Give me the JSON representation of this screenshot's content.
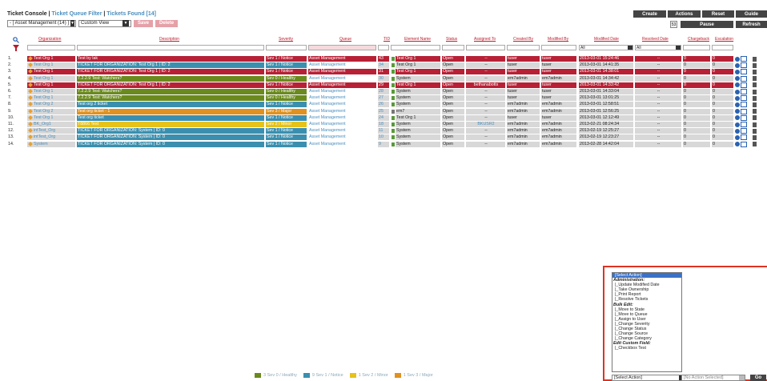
{
  "header": {
    "title": "Ticket Console",
    "sep1": " | ",
    "filter_link": "Ticket Queue Filter",
    "sep2": " | ",
    "found": "Tickets Found [14]",
    "queue_select": "- [ Asset Management (14) ]",
    "view_select": "Custom View",
    "save_label": "Save",
    "delete_label": "Delete",
    "create_label": "Create",
    "actions_label": "Actions",
    "reset_label": "Reset",
    "guide_label": "Guide",
    "pause_label": "Pause",
    "refresh_label": "Refresh",
    "counter": "53"
  },
  "columns": {
    "organization": "Organization",
    "description": "Description",
    "severity": "Severity",
    "queue": "Queue",
    "tid": "TID",
    "element": "Element Name",
    "status": "Status",
    "assigned": "Assigned To",
    "created": "Created By",
    "modified_by": "Modified By",
    "modified_date": "Modified Date",
    "resolved_date": "Resolved Date",
    "chargeback": "Chargeback",
    "escalation": "Escalation"
  },
  "filters": {
    "modified_all": "All",
    "resolved_all": "All"
  },
  "colors": {
    "red": "#b82035",
    "gray": "#9a9a9a",
    "green": "#6a8a1e",
    "orange": "#e0911f",
    "teal": "#3b8fae",
    "yellow": "#e6c21a"
  },
  "rows": [
    {
      "num": "1.",
      "org": "Test Org 1",
      "desc": "Test by lak",
      "sev": "Sev 1 / Notice",
      "queue": "Asset Management",
      "tid": "43",
      "el": "Test Org 1",
      "status": "Open",
      "assigned": "--",
      "created": "tuser",
      "modby": "tuser",
      "moddate": "2013-03-01 15:24:46",
      "resolved": "--",
      "charge": "0",
      "esc": "0",
      "color": "red"
    },
    {
      "num": "2.",
      "org": "Test Org 1",
      "desc": "TICKET FOR ORGANIZATION: Test Org 1 | ID: 2",
      "sev": "Sev 1 / Notice",
      "queue": "Asset Management",
      "tid": "34",
      "el": "Test Org 1",
      "status": "Open",
      "assigned": "--",
      "created": "tuser",
      "modby": "tuser",
      "moddate": "2013-03-01 14:41:35",
      "resolved": "--",
      "charge": "0",
      "esc": "0",
      "color": "gray"
    },
    {
      "num": "3.",
      "org": "Test Org 1",
      "desc": "TICKET FOR ORGANIZATION: Test Org 1 | ID: 2",
      "sev": "Sev 1 / Notice",
      "queue": "Asset Management",
      "tid": "31",
      "el": "Test Org 1",
      "status": "Open",
      "assigned": "--",
      "created": "tuser",
      "modby": "tuser",
      "moddate": "2013-03-01 14:38:01",
      "resolved": "--",
      "charge": "0",
      "esc": "0",
      "color": "red"
    },
    {
      "num": "4.",
      "org": "Test Org 1",
      "desc": "7.2.2.9 Test: Watchers?",
      "sev": "Sev 0 / Healthy",
      "queue": "Asset Management",
      "tid": "30",
      "el": "System",
      "status": "Open",
      "assigned": "--",
      "created": "em7admin",
      "modby": "em7admin",
      "moddate": "2013-03-01 14:34:42",
      "resolved": "--",
      "charge": "0",
      "esc": "0",
      "color": "gray"
    },
    {
      "num": "5.",
      "org": "Test Org 1",
      "desc": "TICKET FOR ORGANIZATION: Test Org 1 | ID: 2",
      "sev": "Sev 1 / Notice",
      "queue": "Asset Management",
      "tid": "29",
      "el": "Test Org 1",
      "status": "Open",
      "assigned": "bethanabotts",
      "created": "tuser",
      "modby": "tuser",
      "moddate": "2013-03-01 14:33:42",
      "resolved": "--",
      "charge": "0",
      "esc": "0",
      "color": "red"
    },
    {
      "num": "6.",
      "org": "Test Org 1",
      "desc": "7.2.2.9 Test: Watchers?",
      "sev": "Sev 0 / Healthy",
      "queue": "Asset Management",
      "tid": "28",
      "el": "System",
      "status": "Open",
      "assigned": "--",
      "created": "tuser",
      "modby": "tuser",
      "moddate": "2013-03-01 14:33:04",
      "resolved": "--",
      "charge": "0",
      "esc": "0",
      "color": "gray"
    },
    {
      "num": "7.",
      "org": "Test Org 1",
      "desc": "7.2.2.9 Test: Watchers?",
      "sev": "Sev 0 / Healthy",
      "queue": "Asset Management",
      "tid": "27",
      "el": "System",
      "status": "Open",
      "assigned": "--",
      "created": "tuser",
      "modby": "tuser",
      "moddate": "2013-03-01 13:01:25",
      "resolved": "--",
      "charge": "0",
      "esc": "0",
      "color": "gray"
    },
    {
      "num": "8.",
      "org": "Test Org 2",
      "desc": "Test org 2 ticket",
      "sev": "Sev 1 / Notice",
      "queue": "Asset Management",
      "tid": "26",
      "el": "System",
      "status": "Open",
      "assigned": "--",
      "created": "em7admin",
      "modby": "em7admin",
      "moddate": "2013-03-01 12:58:51",
      "resolved": "--",
      "charge": "0",
      "esc": "0",
      "color": "gray"
    },
    {
      "num": "9.",
      "org": "Test Org 2",
      "desc": "Test org ticket - 1",
      "sev": "Sev 3 / Major",
      "queue": "Asset Management",
      "tid": "25",
      "el": "em7",
      "status": "Open",
      "assigned": "--",
      "created": "em7admin",
      "modby": "em7admin",
      "moddate": "2013-03-01 12:56:25",
      "resolved": "--",
      "charge": "0",
      "esc": "0",
      "color": "gray"
    },
    {
      "num": "10.",
      "org": "Test Org 1",
      "desc": "Test org ticket",
      "sev": "Sev 1 / Notice",
      "queue": "Asset Management",
      "tid": "24",
      "el": "Test Org 1",
      "status": "Open",
      "assigned": "--",
      "created": "tuser",
      "modby": "tuser",
      "moddate": "2013-03-01 12:12:49",
      "resolved": "--",
      "charge": "0",
      "esc": "0",
      "color": "gray"
    },
    {
      "num": "11.",
      "org": "BK_Org1",
      "desc": "T8866 Test",
      "sev": "Sev 2 / Minor",
      "queue": "Asset Management",
      "tid": "18",
      "el": "System",
      "status": "Open",
      "assigned": "BKUSR2",
      "created": "em7admin",
      "modby": "em7admin",
      "moddate": "2013-02-21 08:24:34",
      "resolved": "--",
      "charge": "0",
      "esc": "0",
      "color": "gray"
    },
    {
      "num": "12.",
      "org": "intTest_Org",
      "desc": "TICKET FOR ORGANIZATION: System | ID: 0",
      "sev": "Sev 1 / Notice",
      "queue": "Asset Management",
      "tid": "11",
      "el": "System",
      "status": "Open",
      "assigned": "--",
      "created": "em7admin",
      "modby": "em7admin",
      "moddate": "2013-02-19 12:25:27",
      "resolved": "--",
      "charge": "0",
      "esc": "0",
      "color": "gray"
    },
    {
      "num": "13.",
      "org": "intTest_Org",
      "desc": "TICKET FOR ORGANIZATION: System | ID: 0",
      "sev": "Sev 1 / Notice",
      "queue": "Asset Management",
      "tid": "10",
      "el": "System",
      "status": "Open",
      "assigned": "--",
      "created": "em7admin",
      "modby": "em7admin",
      "moddate": "2013-02-19 12:23:27",
      "resolved": "--",
      "charge": "0",
      "esc": "0",
      "color": "gray"
    },
    {
      "num": "14.",
      "org": "System",
      "desc": "TICKET FOR ORGANIZATION: System | ID: 0",
      "sev": "Sev 1 / Notice",
      "queue": "Asset Management",
      "tid": "9",
      "el": "System",
      "status": "Open",
      "assigned": "--",
      "created": "em7admin",
      "modby": "em7admin",
      "moddate": "2013-02-28 14:42:04",
      "resolved": "--",
      "charge": "0",
      "esc": "0",
      "color": "gray"
    }
  ],
  "action_menu": [
    {
      "label": "[Select Action]",
      "type": "selected"
    },
    {
      "label": "Administration:",
      "type": "group"
    },
    {
      "label": "|_Update Modified Date",
      "type": "item"
    },
    {
      "label": "|_Take Ownership",
      "type": "item"
    },
    {
      "label": "|_Print Report",
      "type": "item"
    },
    {
      "label": "|_Resolve Tickets",
      "type": "item"
    },
    {
      "label": "Bulk Edit:",
      "type": "group"
    },
    {
      "label": "|_Move to State",
      "type": "item"
    },
    {
      "label": "|_Move to Queue",
      "type": "item"
    },
    {
      "label": "|_Assign to User",
      "type": "item"
    },
    {
      "label": "|_Change Severity",
      "type": "item"
    },
    {
      "label": "|_Change Status",
      "type": "item"
    },
    {
      "label": "|_Change Source",
      "type": "item"
    },
    {
      "label": "|_Change Category",
      "type": "item"
    },
    {
      "label": "Edit Custom Field:",
      "type": "group"
    },
    {
      "label": "|_Checkbox Test",
      "type": "item"
    }
  ],
  "bottom": {
    "select_action": "[Select Action]",
    "no_action": "[No Action Selected]",
    "go_label": "Go"
  },
  "legend": [
    {
      "label": "3 Sev 0 / Healthy",
      "color": "#6a8a1e"
    },
    {
      "label": "9 Sev 1 / Notice",
      "color": "#3b8fae"
    },
    {
      "label": "1 Sev 2 / Minor",
      "color": "#e6c21a"
    },
    {
      "label": "1 Sev 3 / Major",
      "color": "#e0911f"
    }
  ]
}
